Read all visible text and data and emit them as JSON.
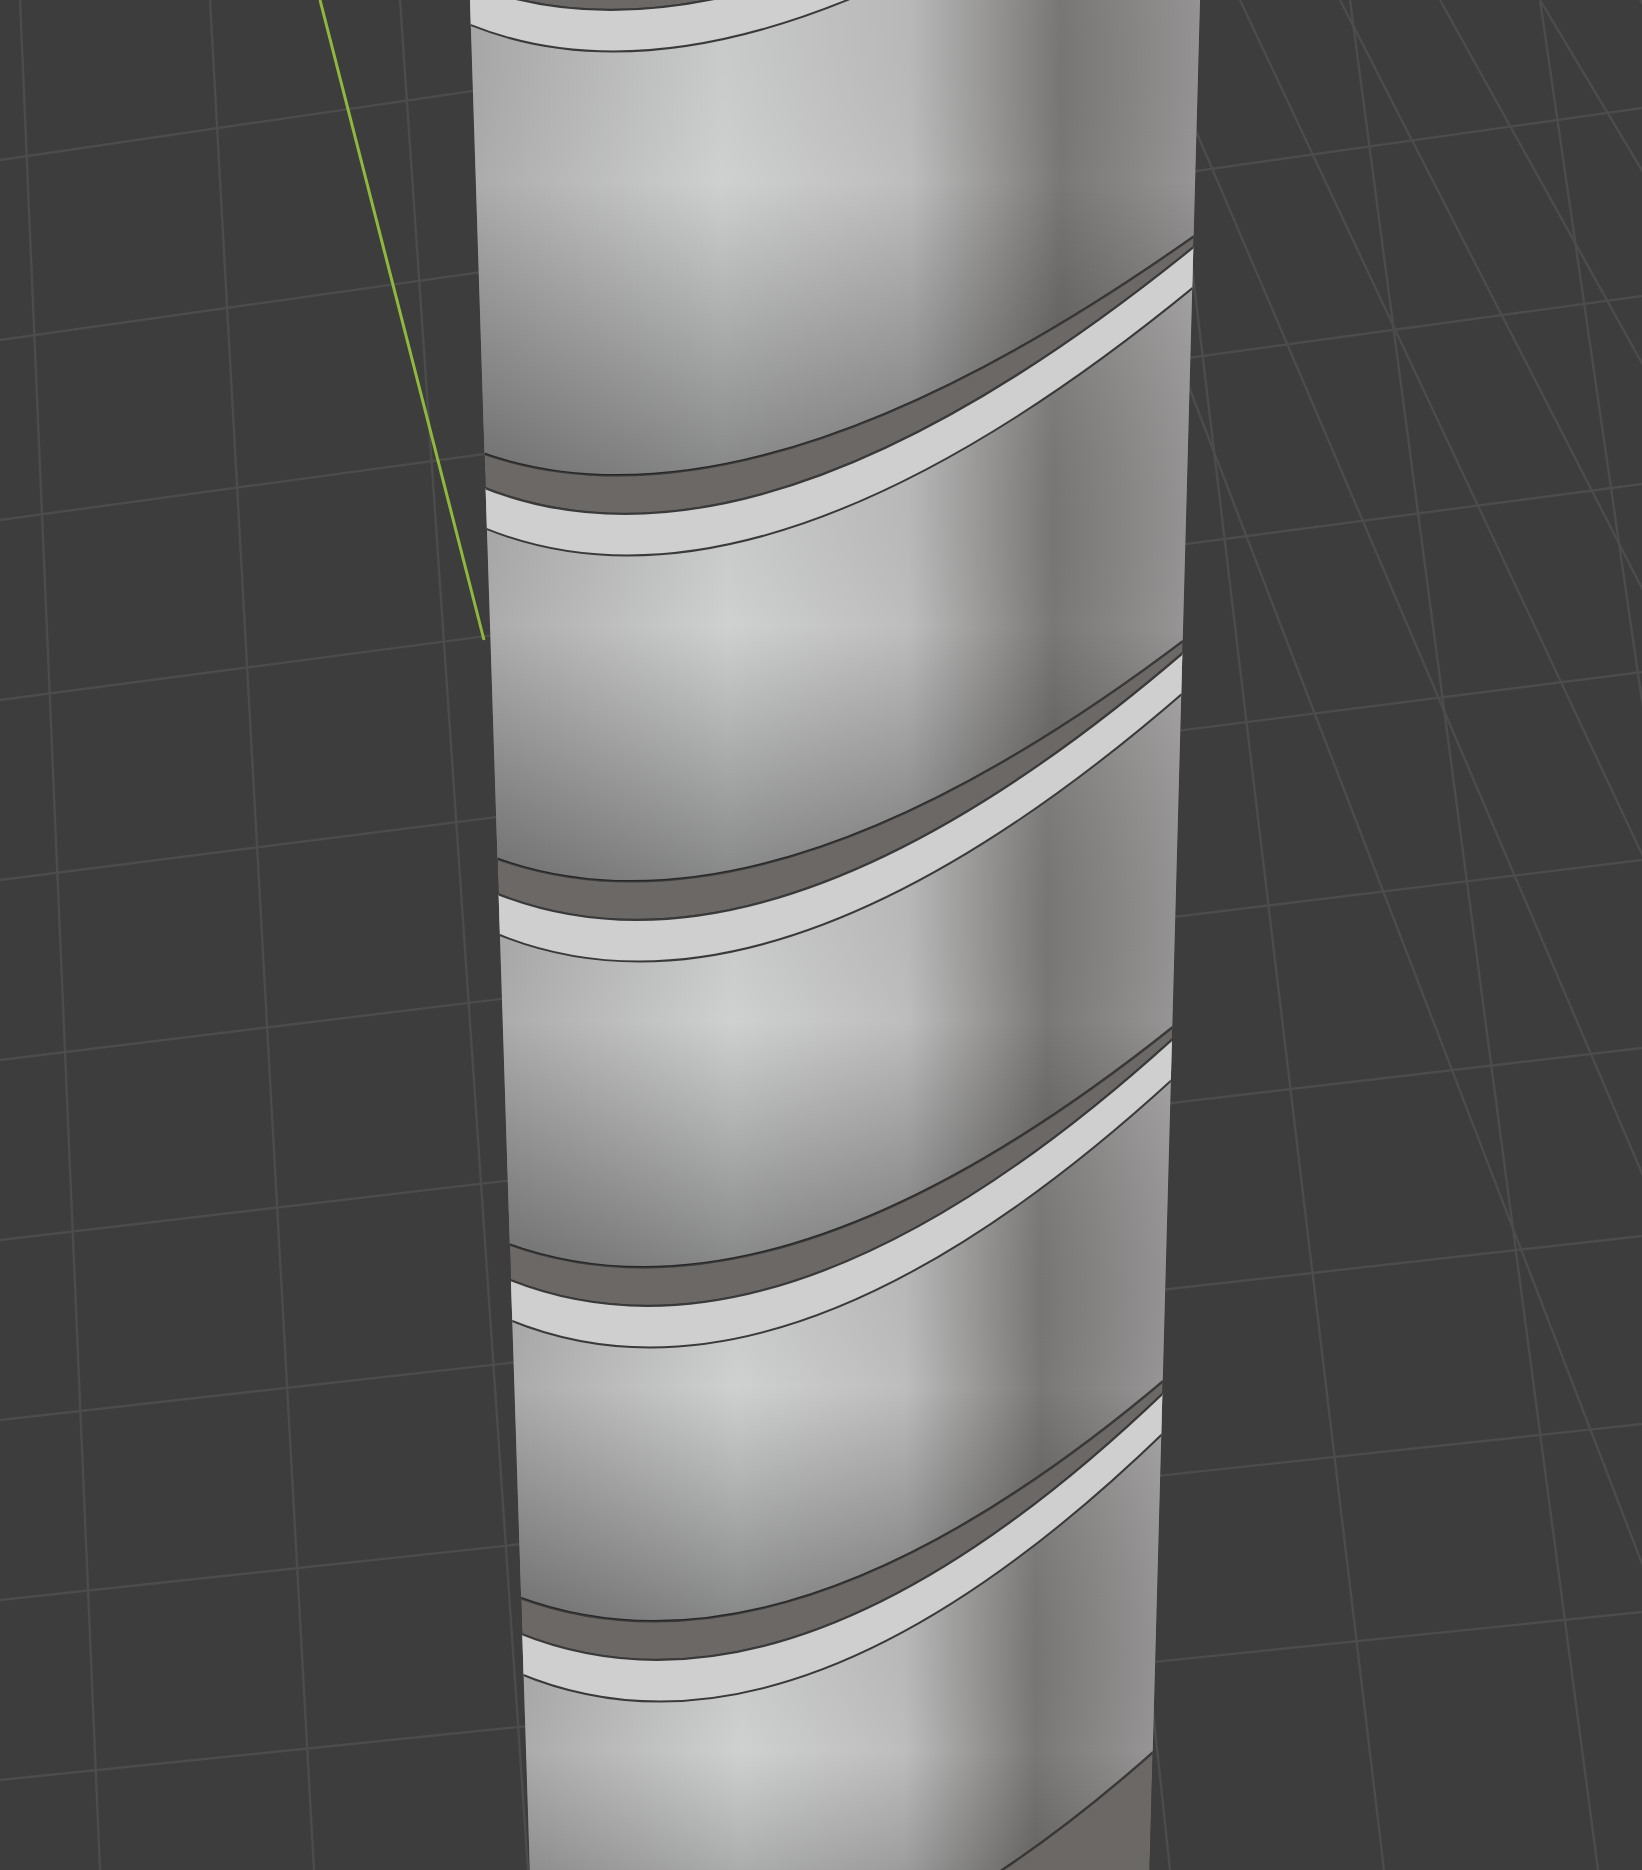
{
  "viewport": {
    "grid_visible": true,
    "axis_visible": true
  }
}
